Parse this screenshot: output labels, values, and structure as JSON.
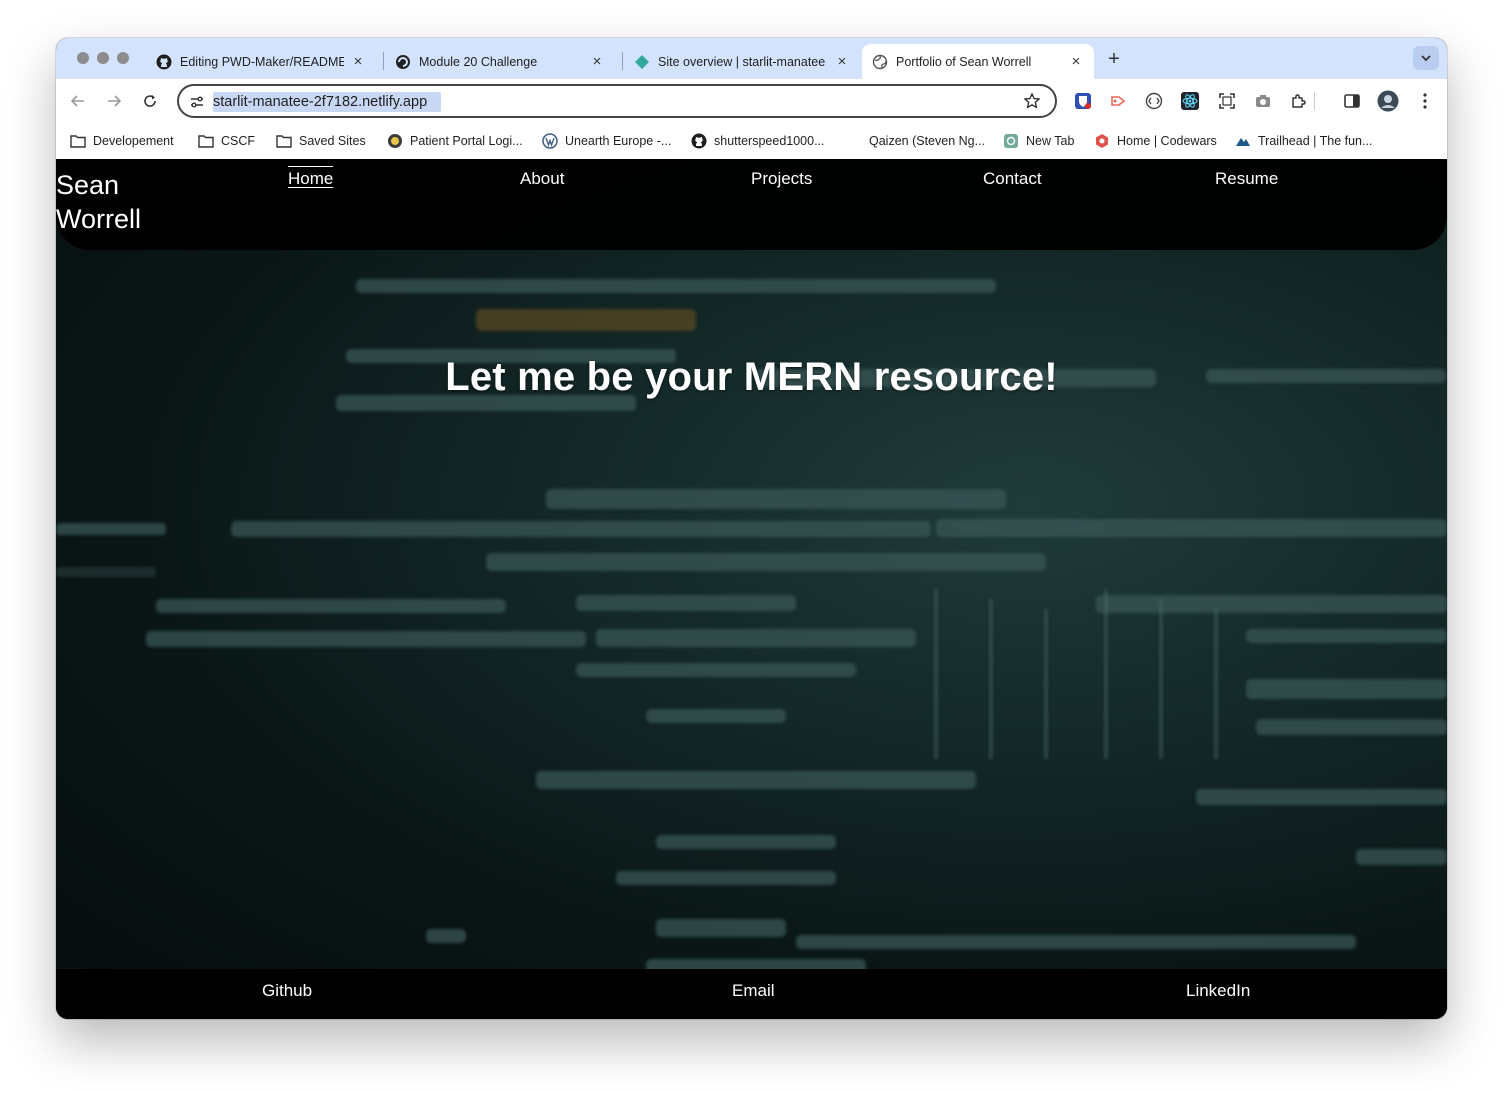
{
  "browser": {
    "tabs": [
      {
        "title": "Editing PWD-Maker/README",
        "icon": "github-icon"
      },
      {
        "title": "Module 20 Challenge",
        "icon": "courseware-icon"
      },
      {
        "title": "Site overview | starlit-manatee",
        "icon": "netlify-icon"
      },
      {
        "title": "Portfolio of Sean Worrell",
        "icon": "globe-icon",
        "active": true
      }
    ],
    "address": "starlit-manatee-2f7182.netlify.app",
    "bookmarks": [
      {
        "label": "Developement",
        "icon": "folder-icon"
      },
      {
        "label": "CSCF",
        "icon": "folder-icon"
      },
      {
        "label": "Saved Sites",
        "icon": "folder-icon"
      },
      {
        "label": "Patient Portal Logi...",
        "icon": "portal-icon"
      },
      {
        "label": "Unearth Europe -...",
        "icon": "wordpress-icon"
      },
      {
        "label": "shutterspeed1000...",
        "icon": "github-icon"
      },
      {
        "label": "Qaizen (Steven Ng...",
        "icon": "blank-icon"
      },
      {
        "label": "New Tab",
        "icon": "chatgpt-icon"
      },
      {
        "label": "Home | Codewars",
        "icon": "codewars-icon"
      },
      {
        "label": "Trailhead | The fun...",
        "icon": "trailhead-icon"
      }
    ]
  },
  "site": {
    "name": "Sean Worrell",
    "nav": [
      "Home",
      "About",
      "Projects",
      "Contact",
      "Resume"
    ],
    "active_nav": "Home",
    "hero": "Let me be your MERN resource!",
    "footer": [
      "Github",
      "Email",
      "LinkedIn"
    ]
  },
  "colors": {
    "tab_strip": "#d3e3fd",
    "header_bg": "#000000",
    "page_bg_accent": "#213b3b",
    "text": "#ffffff"
  }
}
